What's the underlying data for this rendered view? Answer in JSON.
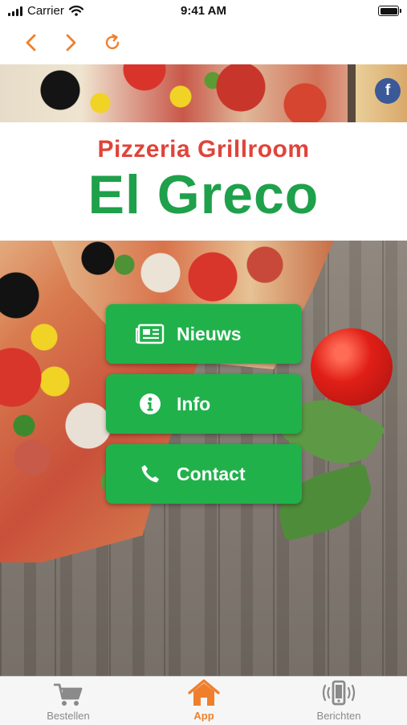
{
  "status_bar": {
    "carrier": "Carrier",
    "time": "9:41 AM",
    "battery_percent": 100
  },
  "navigation": {
    "back_icon": "chevron-left-icon",
    "forward_icon": "chevron-right-icon",
    "reload_icon": "reload-icon"
  },
  "header": {
    "facebook_label": "f",
    "title_sub": "Pizzeria Grillroom",
    "title_main": "El Greco"
  },
  "menu": [
    {
      "label": "Nieuws",
      "icon": "newspaper-icon"
    },
    {
      "label": "Info",
      "icon": "info-icon"
    },
    {
      "label": "Contact",
      "icon": "phone-icon"
    }
  ],
  "tabs": [
    {
      "label": "Bestellen",
      "icon": "cart-icon",
      "active": false
    },
    {
      "label": "App",
      "icon": "home-icon",
      "active": true
    },
    {
      "label": "Berichten",
      "icon": "vibrating-phone-icon",
      "active": false
    }
  ],
  "colors": {
    "accent_orange": "#f07f2d",
    "title_red": "#e0443a",
    "title_green": "#1fa04a",
    "button_green": "#21b14b",
    "facebook_blue": "#3b5998",
    "tab_inactive": "#8a8a8a"
  }
}
